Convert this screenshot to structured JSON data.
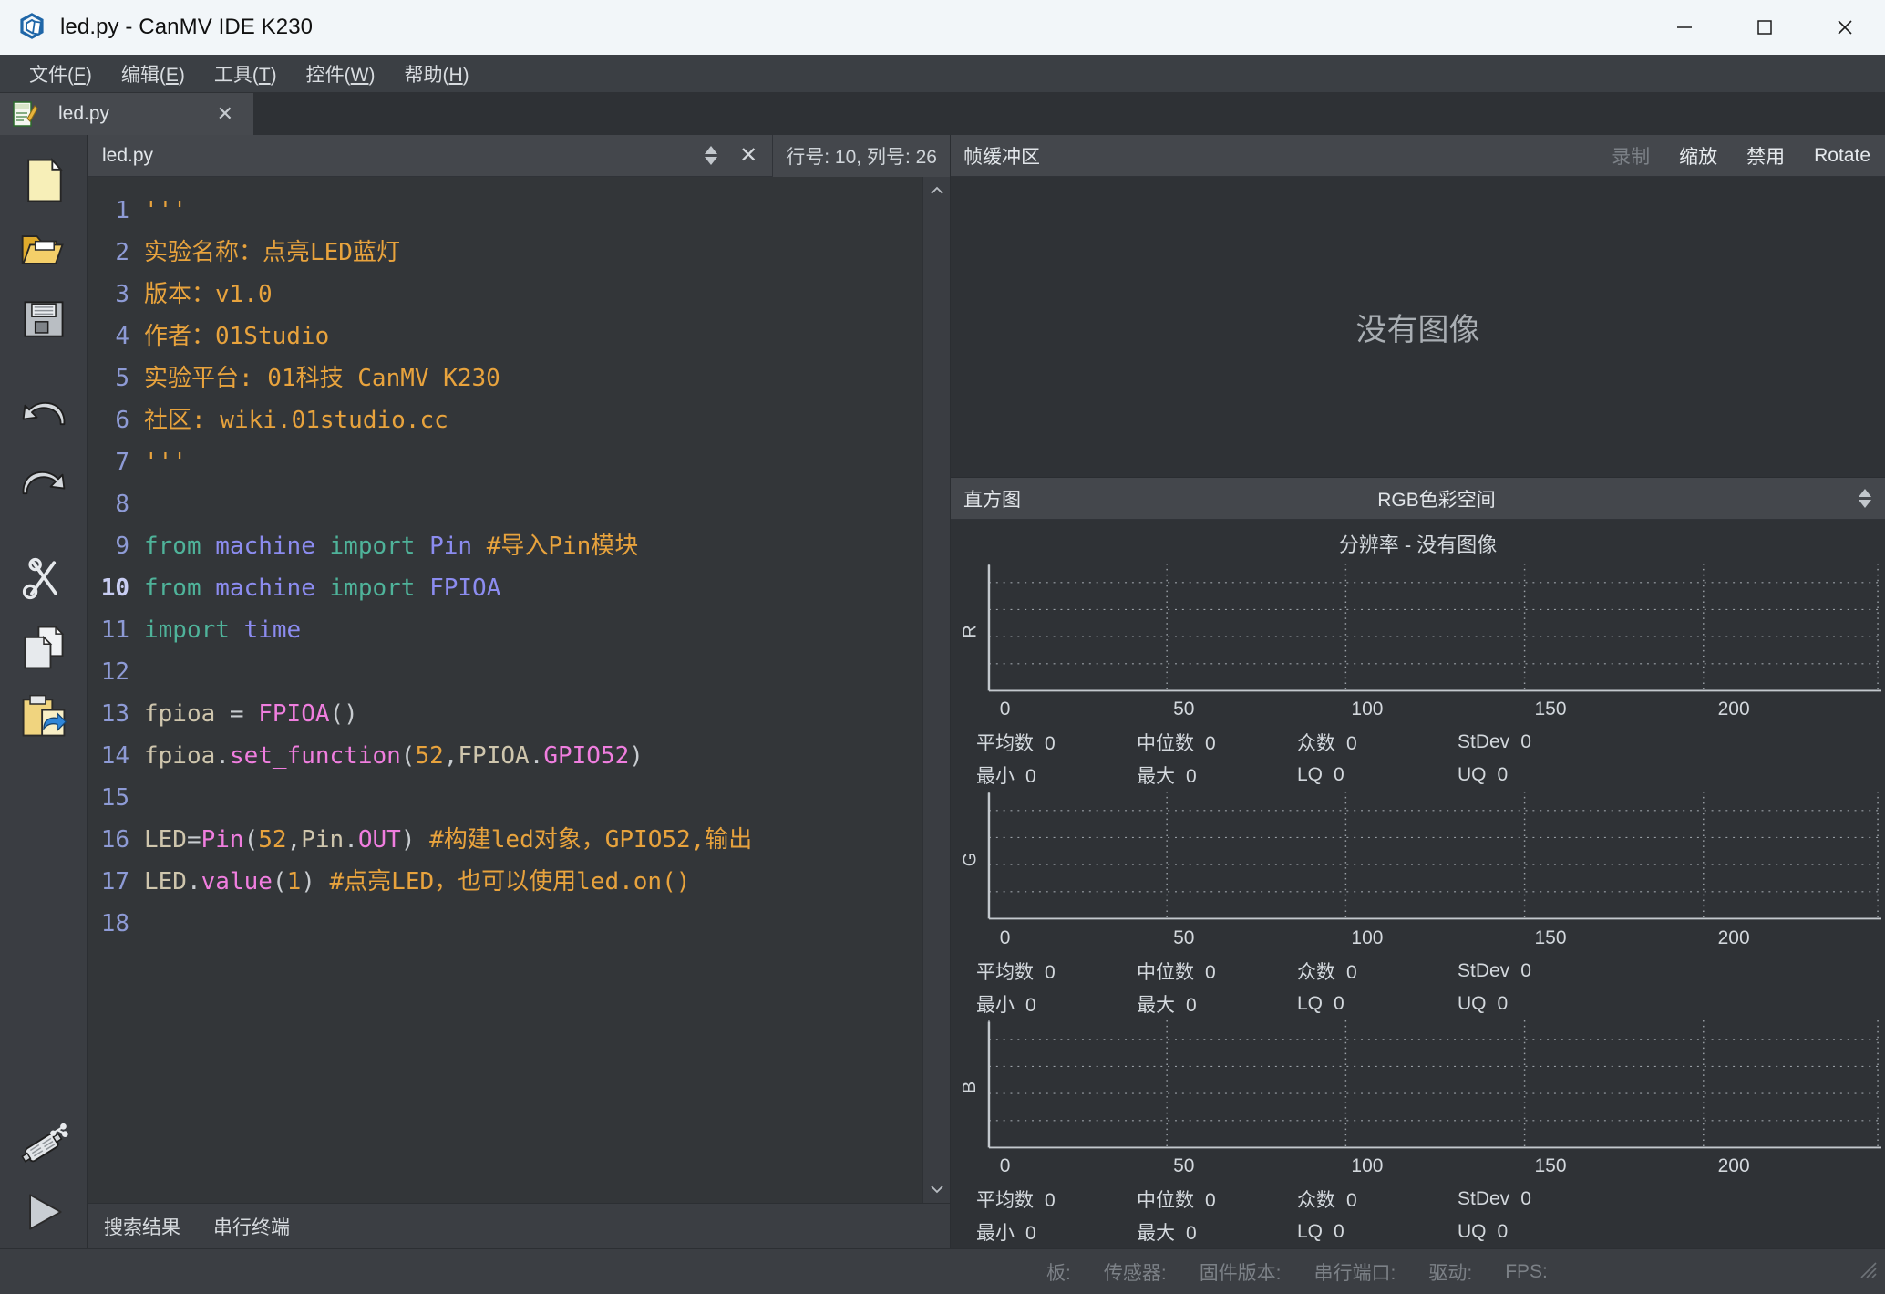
{
  "window": {
    "title": "led.py - CanMV IDE K230",
    "app_icon": "canmv-logo-icon",
    "minimize": "─",
    "maximize": "☐",
    "close": "✕"
  },
  "menubar": {
    "items": [
      {
        "name": "file",
        "text": "文件(F)",
        "label": "文件(",
        "mnemonic": "F",
        "tail": ")"
      },
      {
        "name": "edit",
        "text": "编辑(E)",
        "label": "编辑(",
        "mnemonic": "E",
        "tail": ")"
      },
      {
        "name": "tools",
        "text": "工具(T)",
        "label": "工具(",
        "mnemonic": "T",
        "tail": ")"
      },
      {
        "name": "widgets",
        "text": "控件(W)",
        "label": "控件(",
        "mnemonic": "W",
        "tail": ")"
      },
      {
        "name": "help",
        "text": "帮助(H)",
        "label": "帮助(",
        "mnemonic": "H",
        "tail": ")"
      }
    ]
  },
  "filetab": {
    "label": "led.py",
    "close": "✕",
    "icon": "python-file-icon"
  },
  "toolrail": {
    "items": [
      {
        "name": "new-file-icon",
        "label": "新建"
      },
      {
        "name": "open-file-icon",
        "label": "打开"
      },
      {
        "name": "save-file-icon",
        "label": "保存"
      },
      {
        "name": "undo-icon",
        "label": "撤销"
      },
      {
        "name": "redo-icon",
        "label": "重做"
      },
      {
        "name": "cut-icon",
        "label": "剪切"
      },
      {
        "name": "copy-icon",
        "label": "复制"
      },
      {
        "name": "paste-icon",
        "label": "粘贴"
      }
    ],
    "bottom": [
      {
        "name": "usb-connect-icon",
        "label": "连接"
      },
      {
        "name": "run-icon",
        "label": "运行"
      }
    ]
  },
  "editor": {
    "filename": "led.py",
    "close": "✕",
    "cursor_status": "行号: 10, 列号: 26",
    "current_line": 10,
    "scroll_up": "∧",
    "scroll_down": "∨",
    "lines": [
      {
        "n": 1,
        "tokens": [
          {
            "c": "t-str",
            "t": "'''"
          }
        ]
      },
      {
        "n": 2,
        "tokens": [
          {
            "c": "t-str",
            "t": "实验名称：点亮LED蓝灯"
          }
        ]
      },
      {
        "n": 3,
        "tokens": [
          {
            "c": "t-str",
            "t": "版本：v1.0"
          }
        ]
      },
      {
        "n": 4,
        "tokens": [
          {
            "c": "t-str",
            "t": "作者：01Studio"
          }
        ]
      },
      {
        "n": 5,
        "tokens": [
          {
            "c": "t-str",
            "t": "实验平台: 01科技 CanMV K230"
          }
        ]
      },
      {
        "n": 6,
        "tokens": [
          {
            "c": "t-str",
            "t": "社区: wiki.01studio.cc"
          }
        ]
      },
      {
        "n": 7,
        "tokens": [
          {
            "c": "t-str",
            "t": "'''"
          }
        ]
      },
      {
        "n": 8,
        "tokens": []
      },
      {
        "n": 9,
        "tokens": [
          {
            "c": "t-kw",
            "t": "from"
          },
          {
            "c": "t-plain",
            "t": " "
          },
          {
            "c": "t-mod",
            "t": "machine"
          },
          {
            "c": "t-plain",
            "t": " "
          },
          {
            "c": "t-kw",
            "t": "import"
          },
          {
            "c": "t-plain",
            "t": " "
          },
          {
            "c": "t-mod",
            "t": "Pin"
          },
          {
            "c": "t-plain",
            "t": " "
          },
          {
            "c": "t-com",
            "t": "#导入Pin模块"
          }
        ]
      },
      {
        "n": 10,
        "tokens": [
          {
            "c": "t-kw",
            "t": "from"
          },
          {
            "c": "t-plain",
            "t": " "
          },
          {
            "c": "t-mod",
            "t": "machine"
          },
          {
            "c": "t-plain",
            "t": " "
          },
          {
            "c": "t-kw",
            "t": "import"
          },
          {
            "c": "t-plain",
            "t": " "
          },
          {
            "c": "t-mod",
            "t": "FPIOA"
          }
        ]
      },
      {
        "n": 11,
        "tokens": [
          {
            "c": "t-kw",
            "t": "import"
          },
          {
            "c": "t-plain",
            "t": " "
          },
          {
            "c": "t-mod",
            "t": "time"
          }
        ]
      },
      {
        "n": 12,
        "tokens": []
      },
      {
        "n": 13,
        "tokens": [
          {
            "c": "t-id",
            "t": "fpioa "
          },
          {
            "c": "t-op",
            "t": "="
          },
          {
            "c": "t-plain",
            "t": " "
          },
          {
            "c": "t-cls",
            "t": "FPIOA"
          },
          {
            "c": "t-op",
            "t": "()"
          }
        ]
      },
      {
        "n": 14,
        "tokens": [
          {
            "c": "t-id",
            "t": "fpioa"
          },
          {
            "c": "t-op",
            "t": "."
          },
          {
            "c": "t-fn",
            "t": "set_function"
          },
          {
            "c": "t-op",
            "t": "("
          },
          {
            "c": "t-num",
            "t": "52"
          },
          {
            "c": "t-op",
            "t": ","
          },
          {
            "c": "t-id",
            "t": "FPIOA"
          },
          {
            "c": "t-op",
            "t": "."
          },
          {
            "c": "t-cls",
            "t": "GPIO52"
          },
          {
            "c": "t-op",
            "t": ")"
          }
        ]
      },
      {
        "n": 15,
        "tokens": []
      },
      {
        "n": 16,
        "tokens": [
          {
            "c": "t-id",
            "t": "LED"
          },
          {
            "c": "t-op",
            "t": "="
          },
          {
            "c": "t-cls",
            "t": "Pin"
          },
          {
            "c": "t-op",
            "t": "("
          },
          {
            "c": "t-num",
            "t": "52"
          },
          {
            "c": "t-op",
            "t": ","
          },
          {
            "c": "t-id",
            "t": "Pin"
          },
          {
            "c": "t-op",
            "t": "."
          },
          {
            "c": "t-cls",
            "t": "OUT"
          },
          {
            "c": "t-op",
            "t": ")"
          },
          {
            "c": "t-plain",
            "t": " "
          },
          {
            "c": "t-com",
            "t": "#构建led对象，GPIO52,输出"
          }
        ]
      },
      {
        "n": 17,
        "tokens": [
          {
            "c": "t-id",
            "t": "LED"
          },
          {
            "c": "t-op",
            "t": "."
          },
          {
            "c": "t-fn",
            "t": "value"
          },
          {
            "c": "t-op",
            "t": "("
          },
          {
            "c": "t-num",
            "t": "1"
          },
          {
            "c": "t-op",
            "t": ")"
          },
          {
            "c": "t-plain",
            "t": " "
          },
          {
            "c": "t-com",
            "t": "#点亮LED，也可以使用led.on()"
          }
        ]
      },
      {
        "n": 18,
        "tokens": []
      }
    ]
  },
  "bottom_tabs": [
    {
      "name": "search-results",
      "label": "搜索结果"
    },
    {
      "name": "serial-terminal",
      "label": "串行终端"
    }
  ],
  "framebuffer": {
    "title": "帧缓冲区",
    "buttons": [
      {
        "name": "record-button",
        "label": "录制",
        "disabled": true
      },
      {
        "name": "zoom-button",
        "label": "缩放",
        "disabled": false
      },
      {
        "name": "disable-button",
        "label": "禁用",
        "disabled": false
      },
      {
        "name": "rotate-button",
        "label": "Rotate",
        "disabled": false
      }
    ],
    "no_image": "没有图像"
  },
  "histogram": {
    "title": "直方图",
    "colorspace": "RGB色彩空间",
    "resolution": "分辨率 - 没有图像",
    "axis_ticks": [
      "0",
      "50",
      "100",
      "150",
      "200"
    ],
    "channels": [
      {
        "letter": "R",
        "stats_row1": [
          {
            "label": "平均数",
            "value": "0"
          },
          {
            "label": "中位数",
            "value": "0"
          },
          {
            "label": "众数",
            "value": "0"
          },
          {
            "label": "StDev",
            "value": "0"
          }
        ],
        "stats_row2": [
          {
            "label": "最小",
            "value": "0"
          },
          {
            "label": "最大",
            "value": "0"
          },
          {
            "label": "LQ",
            "value": "0"
          },
          {
            "label": "UQ",
            "value": "0"
          }
        ]
      },
      {
        "letter": "G",
        "stats_row1": [
          {
            "label": "平均数",
            "value": "0"
          },
          {
            "label": "中位数",
            "value": "0"
          },
          {
            "label": "众数",
            "value": "0"
          },
          {
            "label": "StDev",
            "value": "0"
          }
        ],
        "stats_row2": [
          {
            "label": "最小",
            "value": "0"
          },
          {
            "label": "最大",
            "value": "0"
          },
          {
            "label": "LQ",
            "value": "0"
          },
          {
            "label": "UQ",
            "value": "0"
          }
        ]
      },
      {
        "letter": "B",
        "stats_row1": [
          {
            "label": "平均数",
            "value": "0"
          },
          {
            "label": "中位数",
            "value": "0"
          },
          {
            "label": "众数",
            "value": "0"
          },
          {
            "label": "StDev",
            "value": "0"
          }
        ],
        "stats_row2": [
          {
            "label": "最小",
            "value": "0"
          },
          {
            "label": "最大",
            "value": "0"
          },
          {
            "label": "LQ",
            "value": "0"
          },
          {
            "label": "UQ",
            "value": "0"
          }
        ]
      }
    ]
  },
  "statusbar": {
    "items": [
      {
        "name": "board",
        "label": "板:"
      },
      {
        "name": "sensor",
        "label": "传感器:"
      },
      {
        "name": "firmware",
        "label": "固件版本:"
      },
      {
        "name": "serial-port",
        "label": "串行端口:"
      },
      {
        "name": "driver",
        "label": "驱动:"
      },
      {
        "name": "fps",
        "label": "FPS:"
      }
    ]
  },
  "colors": {
    "titlebar_bg": "#f2f6f9",
    "chrome_bg": "#3b3f44",
    "editor_bg": "#333639",
    "panel_bg": "#2f3236",
    "accent_string": "#e8a33d",
    "accent_keyword": "#4fb39a",
    "accent_class": "#f07edf",
    "gutter": "#8e9bd6"
  }
}
